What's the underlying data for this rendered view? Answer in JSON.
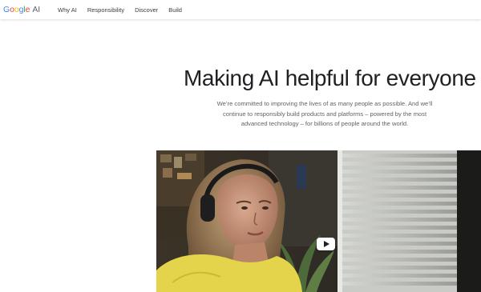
{
  "header": {
    "logo": {
      "letters": [
        "G",
        "o",
        "o",
        "g",
        "l",
        "e"
      ],
      "suffix": "AI"
    },
    "nav": [
      "Why AI",
      "Responsibility",
      "Discover",
      "Build"
    ]
  },
  "hero": {
    "headline": "Making AI helpful for everyone",
    "description": "We’re committed to improving the lives of as many people as possible. And we’ll continue to responsibly build products and platforms – powered by the most advanced technology – for billions of people around the world."
  },
  "video": {
    "play_icon": "play-icon"
  },
  "colors": {
    "google_blue": "#4285F4",
    "google_red": "#EA4335",
    "google_yellow": "#FBBC05",
    "google_green": "#34A853",
    "text_primary": "#202124",
    "text_secondary": "#5f6368"
  }
}
